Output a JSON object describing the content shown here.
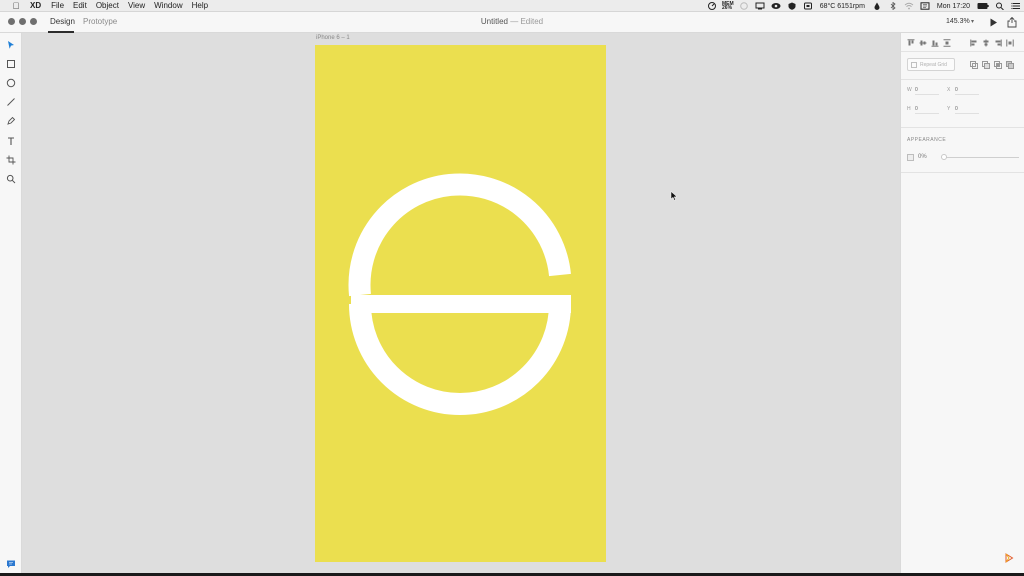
{
  "menubar": {
    "app_name": "XD",
    "items": [
      "File",
      "Edit",
      "Object",
      "View",
      "Window",
      "Help"
    ],
    "status": {
      "memory_label": "MEM",
      "memory_value": "26%",
      "temp_fan": "68°C 6151rpm",
      "clock": "Mon 17:20"
    }
  },
  "toolbar": {
    "tabs": [
      {
        "label": "Design",
        "active": true
      },
      {
        "label": "Prototype",
        "active": false
      }
    ],
    "doc_title": "Untitled",
    "doc_status": "— Edited",
    "zoom": "145.3%"
  },
  "tools": [
    "select-tool",
    "rectangle-tool",
    "ellipse-tool",
    "line-tool",
    "pen-tool",
    "text-tool",
    "artboard-tool",
    "zoom-tool"
  ],
  "canvas": {
    "artboard_name": "iPhone 6 – 1",
    "artboard_color": "#ebdf4f",
    "logo_color": "#ffffff"
  },
  "panel": {
    "repeat_grid_label": "Repeat Grid",
    "fields": {
      "w_label": "W",
      "w_value": "0",
      "x_label": "X",
      "x_value": "0",
      "h_label": "H",
      "h_value": "0",
      "y_label": "Y",
      "y_value": "0"
    },
    "appearance_title": "APPEARANCE",
    "opacity_value": "0%"
  }
}
